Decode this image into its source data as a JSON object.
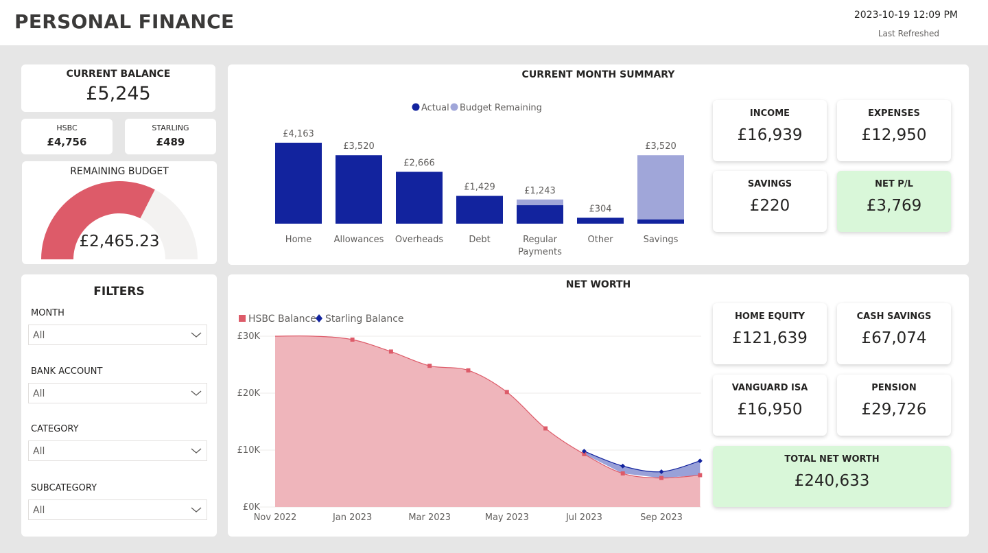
{
  "header": {
    "title": "PERSONAL FINANCE",
    "refreshed_time": "2023-10-19 12:09 PM",
    "refreshed_label": "Last Refreshed"
  },
  "balance": {
    "title": "CURRENT BALANCE",
    "value": "£5,245",
    "accounts": [
      {
        "name": "HSBC",
        "value": "£4,756"
      },
      {
        "name": "STARLING",
        "value": "£489"
      }
    ]
  },
  "remaining_budget": {
    "title": "REMAINING BUDGET",
    "value": "£2,465.23",
    "fraction_used": 0.65,
    "colors": {
      "used": "#dd5b69",
      "remaining": "#f3f2f1"
    }
  },
  "filters": {
    "title": "FILTERS",
    "items": [
      {
        "label": "MONTH",
        "value": "All"
      },
      {
        "label": "BANK ACCOUNT",
        "value": "All"
      },
      {
        "label": "CATEGORY",
        "value": "All"
      },
      {
        "label": "SUBCATEGORY",
        "value": "All"
      }
    ]
  },
  "summary": {
    "title": "CURRENT MONTH SUMMARY",
    "kpis": [
      {
        "title": "INCOME",
        "value": "£16,939"
      },
      {
        "title": "EXPENSES",
        "value": "£12,950"
      },
      {
        "title": "SAVINGS",
        "value": "£220"
      },
      {
        "title": "NET P/L",
        "value": "£3,769"
      }
    ]
  },
  "net_worth": {
    "title": "NET WORTH",
    "kpis": [
      {
        "title": "HOME EQUITY",
        "value": "£121,639"
      },
      {
        "title": "CASH SAVINGS",
        "value": "£67,074"
      },
      {
        "title": "VANGUARD ISA",
        "value": "£16,950"
      },
      {
        "title": "PENSION",
        "value": "£29,726"
      },
      {
        "title": "TOTAL NET WORTH",
        "value": "£240,633"
      }
    ]
  },
  "icons": {
    "filter_dropdown": "chevron-down-icon"
  },
  "colors": {
    "actual": "#12239e",
    "budget_remaining": "#a0a6d9",
    "hsbc": "#dd5b69",
    "hsbc_fill": "#efb5bb",
    "starling": "#12239e",
    "starling_fill": "#8e97d4",
    "positive": "#d9f7d9"
  },
  "chart_data": [
    {
      "type": "bar",
      "stacked": true,
      "legend": [
        "Actual",
        "Budget Remaining"
      ],
      "legend_position": "top",
      "categories": [
        "Home",
        "Allowances",
        "Overheads",
        "Debt",
        "Regular Payments",
        "Other",
        "Savings"
      ],
      "category_lines": [
        [
          "Home"
        ],
        [
          "Allowances"
        ],
        [
          "Overheads"
        ],
        [
          "Debt"
        ],
        [
          "Regular",
          "Payments"
        ],
        [
          "Other"
        ],
        [
          "Savings"
        ]
      ],
      "series": [
        {
          "name": "Actual",
          "values": [
            4163,
            3520,
            2666,
            1429,
            950,
            304,
            220
          ]
        },
        {
          "name": "Budget Remaining",
          "values": [
            0,
            0,
            0,
            0,
            293,
            0,
            3300
          ]
        }
      ],
      "data_labels": [
        "£4,163",
        "£3,520",
        "£2,666",
        "£1,429",
        "£1,243",
        "£304",
        "£3,520"
      ],
      "totals": [
        4163,
        3520,
        2666,
        1429,
        1243,
        304,
        3520
      ],
      "ylim": [
        0,
        4800
      ],
      "grid": false
    },
    {
      "type": "area",
      "legend": [
        "HSBC Balance",
        "Starling Balance"
      ],
      "legend_position": "top-left",
      "x": [
        "2022-11",
        "2022-12",
        "2023-01",
        "2023-02",
        "2023-03",
        "2023-04",
        "2023-05",
        "2023-06",
        "2023-07",
        "2023-08",
        "2023-09",
        "2023-10"
      ],
      "x_tick_labels": [
        "Nov 2022",
        "Jan 2023",
        "Mar 2023",
        "May 2023",
        "Jul 2023",
        "Sep 2023"
      ],
      "x_tick_indices": [
        0,
        2,
        4,
        6,
        8,
        10
      ],
      "series": [
        {
          "name": "HSBC Balance",
          "values": [
            30200,
            30100,
            29400,
            27300,
            24800,
            24000,
            20200,
            13800,
            9300,
            5900,
            5100,
            5600
          ]
        },
        {
          "name": "Starling Balance",
          "values": [
            null,
            null,
            null,
            null,
            null,
            null,
            null,
            null,
            9800,
            7200,
            6200,
            8100
          ]
        }
      ],
      "y_ticks": [
        0,
        10000,
        20000,
        30000
      ],
      "y_tick_labels": [
        "£0K",
        "£10K",
        "£20K",
        "£30K"
      ],
      "ylim": [
        0,
        30000
      ],
      "grid": true
    }
  ]
}
